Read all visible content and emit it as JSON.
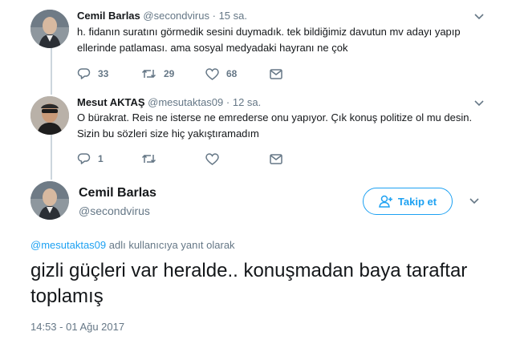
{
  "tweets": [
    {
      "name": "Cemil Barlas",
      "handle": "@secondvirus",
      "separator": "·",
      "time": "15 sa.",
      "text": "h. fidanın suratını görmedik sesini duymadık. tek bildiğimiz davutun mv adayı yapıp ellerinde patlaması. ama sosyal medyadaki hayranı ne çok",
      "counts": {
        "reply": "33",
        "retweet": "29",
        "like": "68"
      }
    },
    {
      "name": "Mesut AKTAŞ",
      "handle": "@mesutaktas09",
      "separator": "·",
      "time": "12 sa.",
      "text": "O bürakrat. Reis ne isterse ne emrederse onu yapıyor. Çık konuş politize ol mu desin. Sizin bu sözleri size hiç yakıştıramadım",
      "counts": {
        "reply": "1",
        "retweet": "",
        "like": ""
      }
    }
  ],
  "main": {
    "name": "Cemil Barlas",
    "handle": "@secondvirus",
    "follow_label": "Takip et",
    "reply_to_handle": "@mesutaktas09",
    "reply_to_text": " adlı kullanıcıya yanıt olarak",
    "text": "gizli güçleri var heralde.. konuşmadan baya taraftar toplamış",
    "timestamp": "14:53 - 01 Ağu 2017"
  },
  "icons": {
    "reply": "reply-icon",
    "retweet": "retweet-icon",
    "like": "heart-icon",
    "dm": "envelope-icon",
    "caret": "chevron-down-icon",
    "follow": "add-user-icon"
  },
  "colors": {
    "accent": "#1da1f2",
    "muted": "#657786",
    "text": "#14171a",
    "line": "#ccd6dd"
  }
}
